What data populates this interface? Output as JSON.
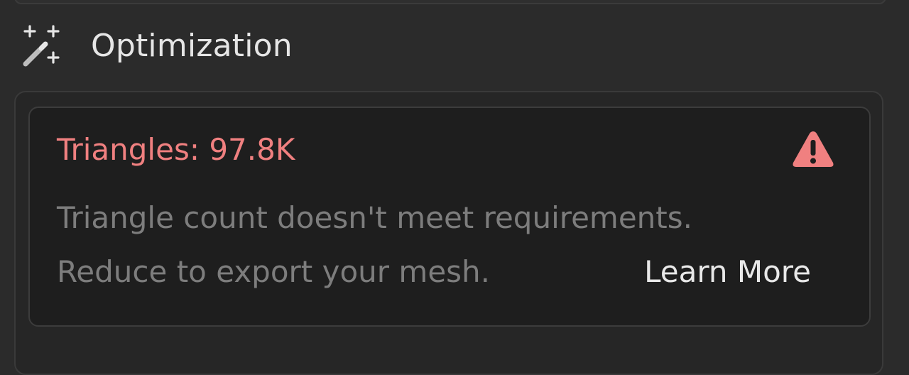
{
  "section": {
    "title": "Optimization",
    "icon": "magic-wand-sparkles-icon"
  },
  "card": {
    "title": "Triangles: 97.8K",
    "title_color": "#f08080",
    "warning_icon": "warning-triangle-icon",
    "message_line_1": "Triangle count doesn't meet requirements.",
    "message_line_2": "Reduce to export your mesh.",
    "learn_more_label": "Learn More"
  },
  "colors": {
    "background": "#2b2b2b",
    "card_background": "#1e1e1e",
    "warning": "#f08080",
    "muted_text": "#7d7d7d",
    "primary_text": "#e8e8e8"
  }
}
